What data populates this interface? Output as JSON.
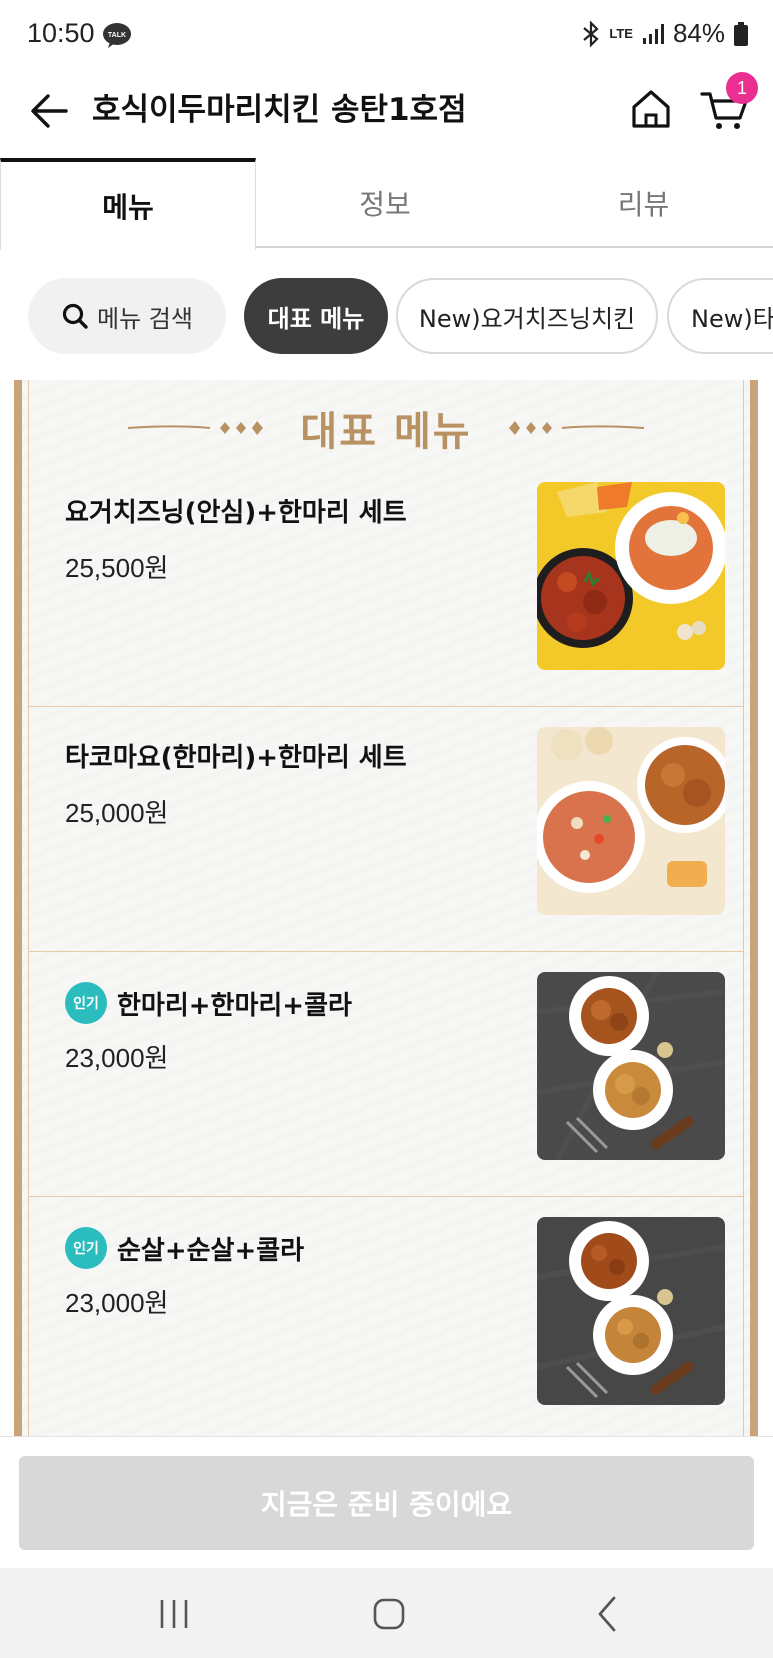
{
  "status_bar": {
    "time": "10:50",
    "talk_icon_text": "TALK",
    "network": "LTE",
    "battery": "84%"
  },
  "header": {
    "title": "호식이두마리치킨 송탄1호점",
    "cart_count": "1"
  },
  "tabs": [
    {
      "label": "메뉴",
      "active": true
    },
    {
      "label": "정보",
      "active": false
    },
    {
      "label": "리뷰",
      "active": false
    }
  ],
  "chips": {
    "search": "메뉴 검색",
    "items": [
      "대표 메뉴",
      "New)요거치즈닝치킨",
      "New)타"
    ]
  },
  "board": {
    "title": "대표 메뉴"
  },
  "menu_items": [
    {
      "name": "요거치즈닝(안심)+한마리 세트",
      "price": "25,500원",
      "badge": ""
    },
    {
      "name": "타코마요(한마리)+한마리 세트",
      "price": "25,000원",
      "badge": ""
    },
    {
      "name": "한마리+한마리+콜라",
      "price": "23,000원",
      "badge": "인기"
    },
    {
      "name": "순살+순살+콜라",
      "price": "23,000원",
      "badge": "인기"
    }
  ],
  "cta": {
    "label": "지금은 준비 중이에요"
  },
  "colors": {
    "accent_badge": "#ea2f90",
    "board_gold": "#b99263",
    "popular_badge": "#2bbcbd",
    "chip_active": "#3d3d3d"
  }
}
